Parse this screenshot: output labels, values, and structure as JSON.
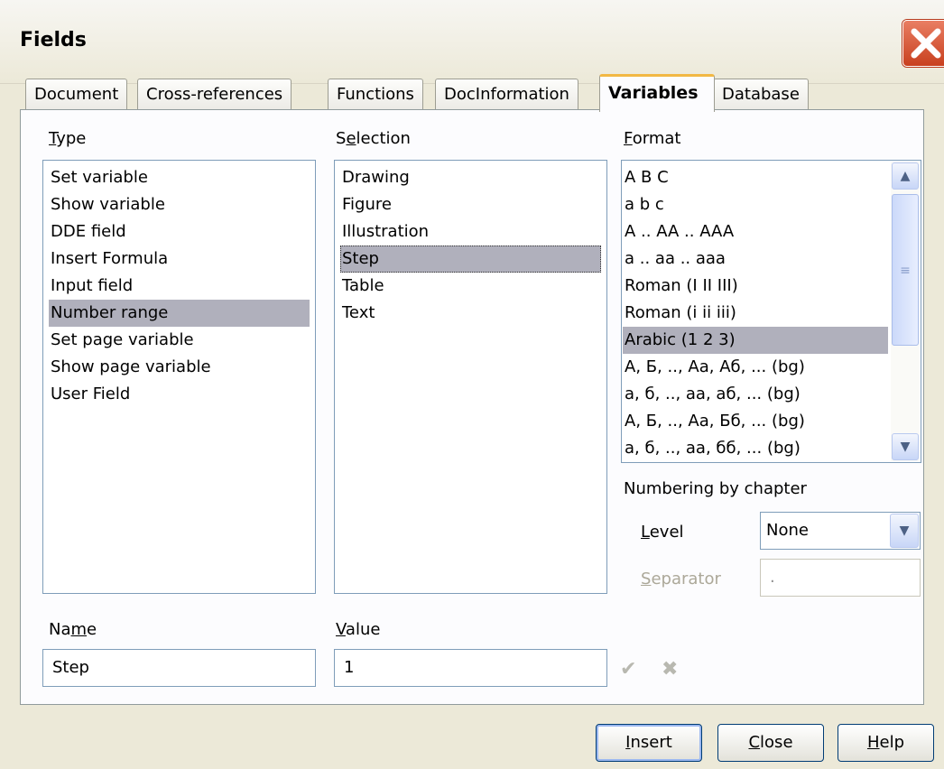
{
  "window": {
    "title": "Fields"
  },
  "tabs": [
    {
      "label": "Document"
    },
    {
      "label": "Cross-references"
    },
    {
      "label": "Functions"
    },
    {
      "label": "DocInformation"
    },
    {
      "label": "Variables",
      "active": true
    },
    {
      "label": "Database"
    }
  ],
  "type": {
    "label_pre": "",
    "label_u": "T",
    "label_post": "ype",
    "items": [
      "Set variable",
      "Show variable",
      "DDE field",
      "Insert Formula",
      "Input field",
      "Number range",
      "Set page variable",
      "Show page variable",
      "User Field"
    ],
    "selected": "Number range"
  },
  "selection": {
    "label_pre": "S",
    "label_u": "e",
    "label_post": "lection",
    "items": [
      "Drawing",
      "Figure",
      "Illustration",
      "Step",
      "Table",
      "Text"
    ],
    "selected": "Step"
  },
  "format": {
    "label_pre": "",
    "label_u": "F",
    "label_post": "ormat",
    "items": [
      "A B C",
      "a b c",
      "A .. AA .. AAA",
      "a .. aa .. aaa",
      "Roman (I II III)",
      "Roman (i ii iii)",
      "Arabic (1 2 3)",
      "А, Б, .., Аа, Аб, ... (bg)",
      "а, б, .., аа, аб, ... (bg)",
      "А, Б, .., Аа, Бб, ... (bg)",
      "а, б, .., аа, бб, ... (bg)"
    ],
    "selected": "Arabic (1 2 3)"
  },
  "numbering": {
    "heading": "Numbering by chapter",
    "level_pre": "",
    "level_u": "L",
    "level_post": "evel",
    "level_value": "None",
    "separator_pre": "",
    "separator_u": "S",
    "separator_post": "eparator",
    "separator_value": "."
  },
  "name": {
    "label_pre": "Na",
    "label_u": "m",
    "label_post": "e",
    "value": "Step"
  },
  "value": {
    "label_pre": "",
    "label_u": "V",
    "label_post": "alue",
    "value": "1"
  },
  "icons": {
    "apply": "checkmark-icon",
    "delete": "x-delete-icon",
    "close": "close-icon"
  },
  "buttons": {
    "insert_u": "I",
    "insert_rest": "nsert",
    "close_u": "C",
    "close_rest": "lose",
    "help_u": "H",
    "help_rest": "elp"
  }
}
